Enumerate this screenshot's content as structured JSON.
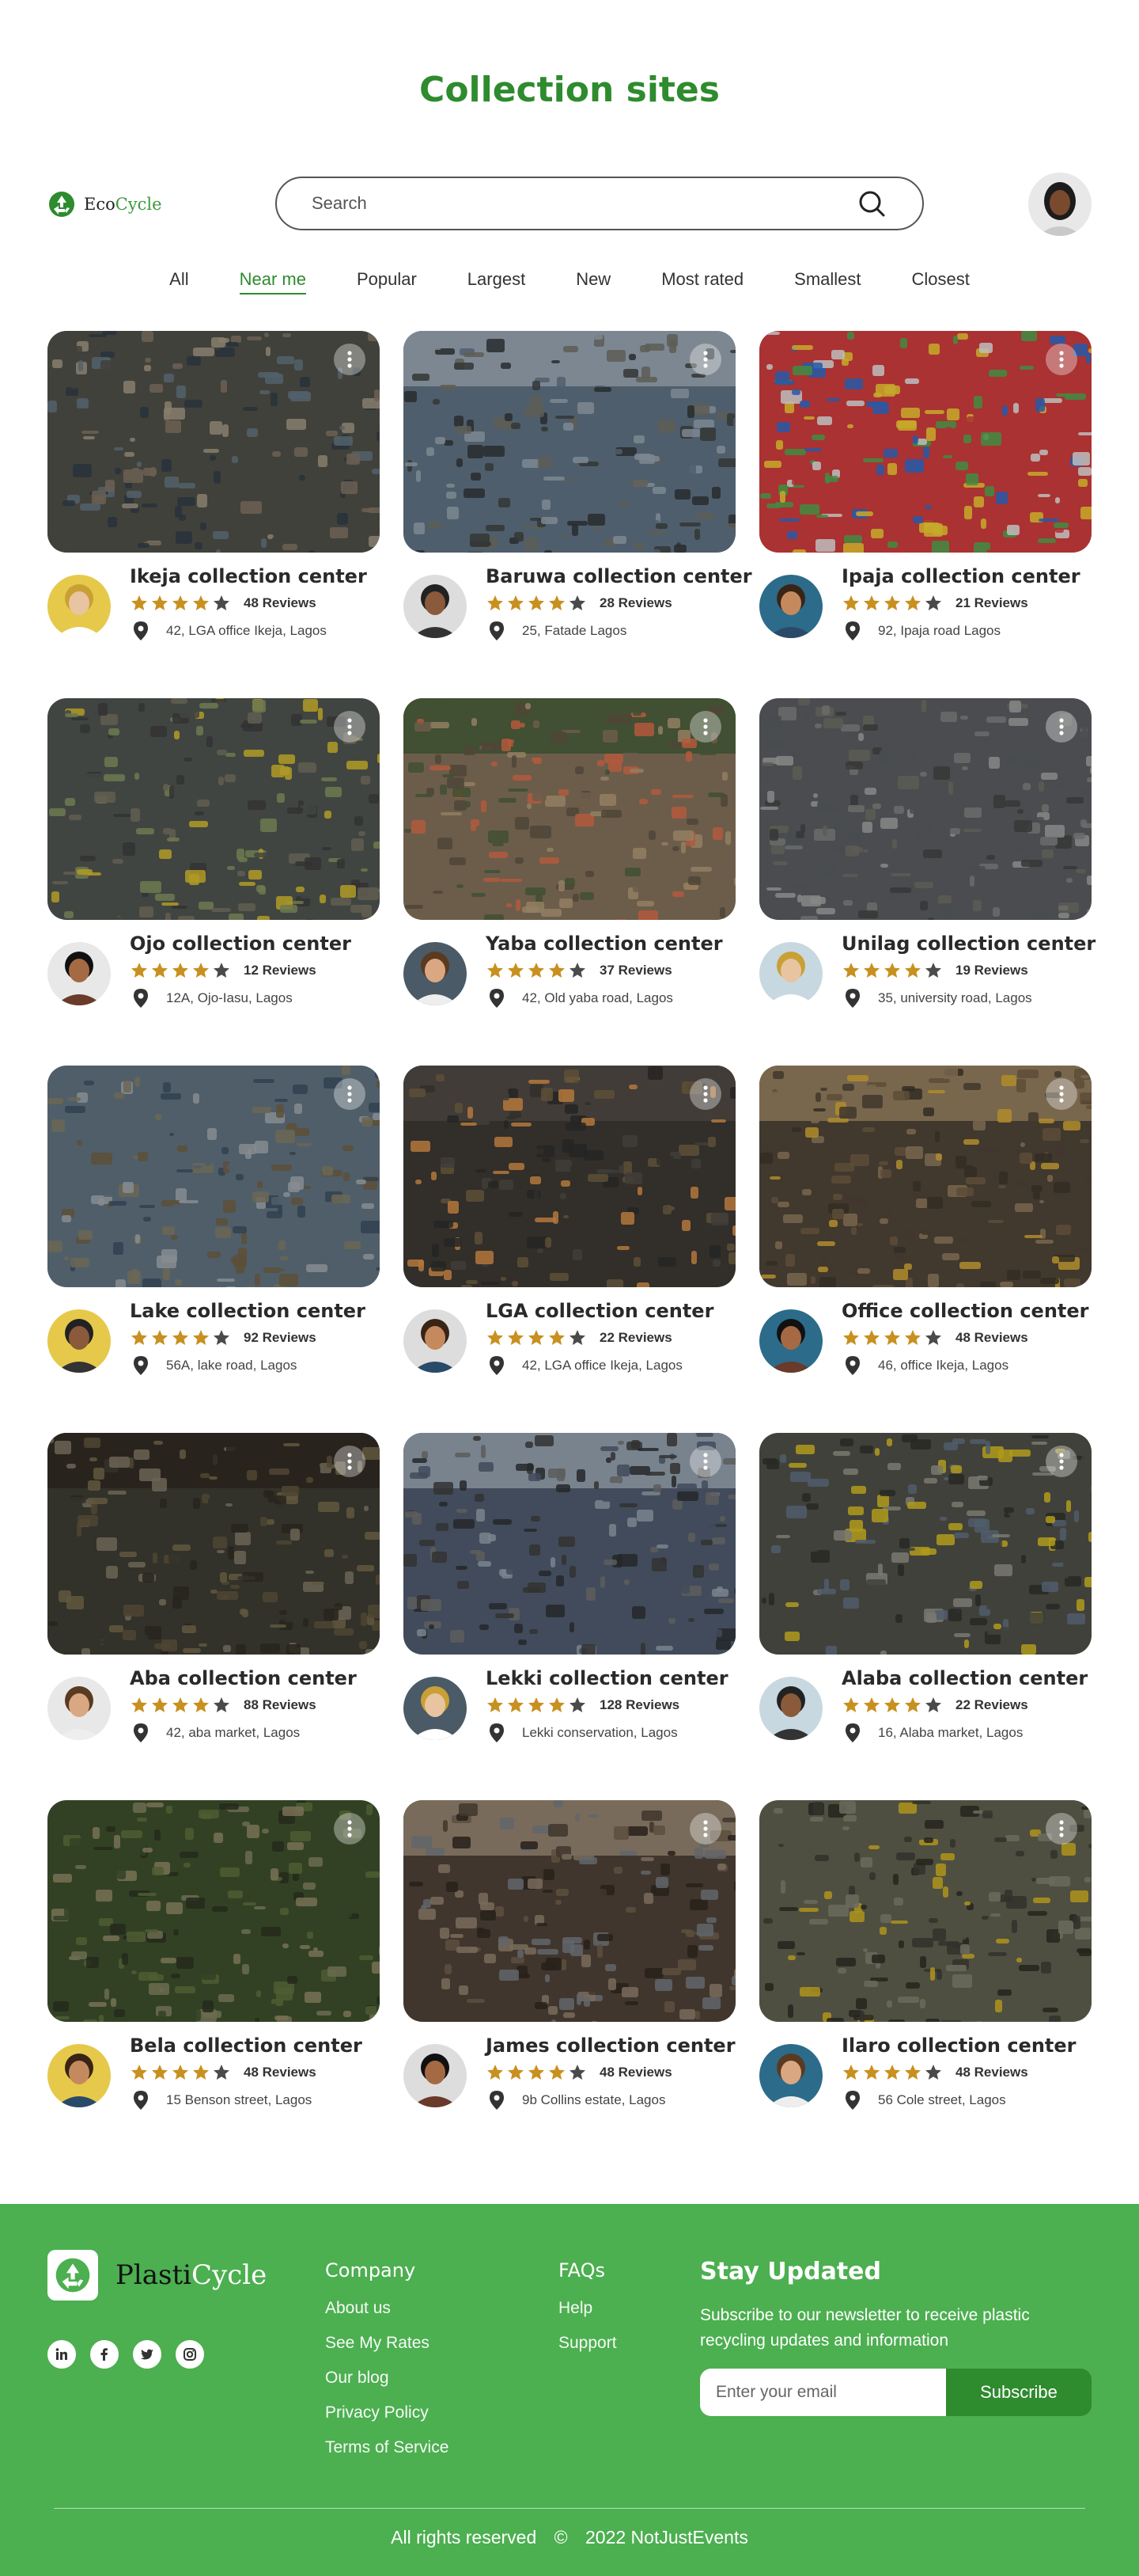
{
  "page": {
    "title": "Collection sites"
  },
  "header": {
    "logo_prefix": "Eco",
    "logo_suffix": "Cycle",
    "search_placeholder": "Search"
  },
  "tabs": [
    {
      "label": "All",
      "active": false
    },
    {
      "label": "Near me",
      "active": true
    },
    {
      "label": "Popular",
      "active": false
    },
    {
      "label": "Largest",
      "active": false
    },
    {
      "label": "New",
      "active": false
    },
    {
      "label": "Most rated",
      "active": false
    },
    {
      "label": "Smallest",
      "active": false
    },
    {
      "label": "Closest",
      "active": false
    }
  ],
  "sites": [
    {
      "name": "Ikeja collection center",
      "rating": 4,
      "reviews": "48 Reviews",
      "address": "42, LGA office Ikeja, Lagos"
    },
    {
      "name": "Baruwa collection center",
      "rating": 4,
      "reviews": "28 Reviews",
      "address": "25, Fatade Lagos"
    },
    {
      "name": "Ipaja collection center",
      "rating": 4,
      "reviews": "21 Reviews",
      "address": "92, Ipaja road Lagos"
    },
    {
      "name": "Ojo collection center",
      "rating": 4,
      "reviews": "12 Reviews",
      "address": "12A, Ojo-Iasu, Lagos"
    },
    {
      "name": "Yaba collection center",
      "rating": 4,
      "reviews": "37 Reviews",
      "address": "42,  Old yaba road, Lagos"
    },
    {
      "name": "Unilag collection center",
      "rating": 4,
      "reviews": "19 Reviews",
      "address": "35, university road, Lagos"
    },
    {
      "name": "Lake collection center",
      "rating": 4,
      "reviews": "92 Reviews",
      "address": "56A, lake road, Lagos"
    },
    {
      "name": "LGA collection center",
      "rating": 4,
      "reviews": "22 Reviews",
      "address": "42, LGA office Ikeja, Lagos"
    },
    {
      "name": "Office collection center",
      "rating": 4,
      "reviews": "48 Reviews",
      "address": "46, office Ikeja, Lagos"
    },
    {
      "name": "Aba collection center",
      "rating": 4,
      "reviews": "88 Reviews",
      "address": "42, aba market, Lagos"
    },
    {
      "name": "Lekki collection center",
      "rating": 4,
      "reviews": "128 Reviews",
      "address": "Lekki conservation, Lagos"
    },
    {
      "name": "Alaba collection center",
      "rating": 4,
      "reviews": "22 Reviews",
      "address": "16, Alaba market, Lagos"
    },
    {
      "name": "Bela collection center",
      "rating": 4,
      "reviews": "48 Reviews",
      "address": "15 Benson street, Lagos"
    },
    {
      "name": "James collection center",
      "rating": 4,
      "reviews": "48 Reviews",
      "address": "9b Collins estate, Lagos"
    },
    {
      "name": "Ilaro collection center",
      "rating": 4,
      "reviews": "48 Reviews",
      "address": "56 Cole street, Lagos"
    }
  ],
  "colors": {
    "brand_green": "#2e8b2e",
    "footer_green": "#4caf50",
    "star": "#c8901f",
    "star_empty": "#4a4a4a"
  },
  "footer": {
    "logo_prefix": "Plasti",
    "logo_suffix": "Cycle",
    "socials": [
      "linkedin-icon",
      "facebook-icon",
      "twitter-icon",
      "instagram-icon"
    ],
    "company": {
      "heading": "Company",
      "links": [
        "About us",
        "See My Rates",
        "Our blog",
        "Privacy Policy",
        "Terms of Service"
      ]
    },
    "faqs": {
      "heading": "FAQs",
      "links": [
        "Help",
        "Support"
      ]
    },
    "newsletter": {
      "heading": "Stay Updated",
      "text": "Subscribe to our newsletter to receive plastic recycling updates and information",
      "placeholder": "Enter your email",
      "button": "Subscribe"
    },
    "rights": "All rights reserved",
    "copyright_symbol": "©",
    "copyright": "2022 NotJustEvents"
  }
}
